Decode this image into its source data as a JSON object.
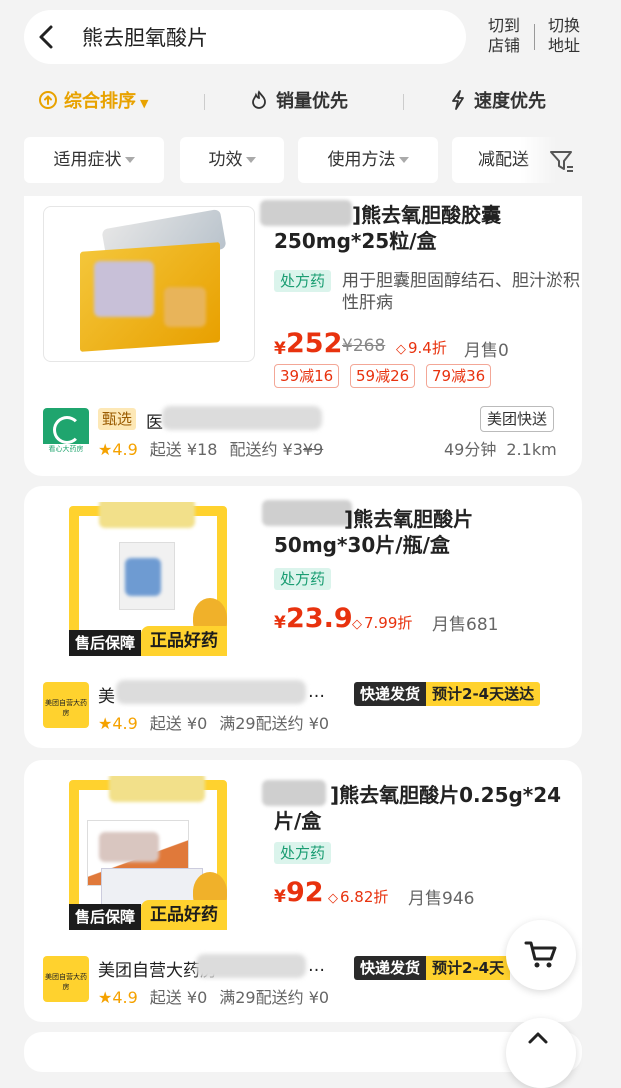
{
  "header": {
    "search_query": "熊去胆氧酸片",
    "action1": [
      "切到",
      "店铺"
    ],
    "action2": [
      "切换",
      "地址"
    ]
  },
  "sort": {
    "items": [
      "综合排序",
      "销量优先",
      "速度优先"
    ],
    "active_index": 0,
    "active_color": "#e8a200"
  },
  "filters": [
    "适用症状",
    "功效",
    "使用方法",
    "减配送"
  ],
  "products": [
    {
      "title_line1": "]熊去氧胆酸胶囊",
      "title_line2": "250mg*25粒/盒",
      "rx_badge": "处方药",
      "description": "用于胆囊胆固醇结石、胆汁淤积性肝病",
      "yen": "¥",
      "price": "252",
      "original_price": "¥268",
      "discount": "9.4折",
      "monthly_sales": "月售0",
      "coupons": [
        "39减16",
        "59减26",
        "79减36"
      ],
      "shop_badge": "甄选",
      "shop_name_visible": "医",
      "rating": "4.9",
      "min_order": "起送 ¥18",
      "delivery_fee": "配送约 ¥3",
      "delivery_fee_original": "¥9",
      "delivery_badge": "美团快送",
      "eta": "49分钟",
      "distance": "2.1km",
      "logo_text": "看心大药房"
    },
    {
      "title_line1": "]熊去氧胆酸片",
      "title_line2": "50mg*30片/瓶/盒",
      "rx_badge": "处方药",
      "yen": "¥",
      "price": "23.9",
      "discount": "7.99折",
      "monthly_sales": "月售681",
      "image_band_left": "售后保障",
      "image_band_right": "正品好药",
      "shop_name_visible": "美",
      "shop_name_tail": "…",
      "rating": "4.9",
      "min_order": "起送 ¥0",
      "delivery_fee": "满29配送约 ¥0",
      "express_a": "快递发货",
      "express_b": "预计2-4天送达",
      "logo_text": "美团自营大药房"
    },
    {
      "title_line1": "]熊去氧胆酸片0.25g*24",
      "title_line2": "片/盒",
      "rx_badge": "处方药",
      "yen": "¥",
      "price": "92",
      "discount": "6.82折",
      "monthly_sales": "月售946",
      "image_band_left": "售后保障",
      "image_band_right": "正品好药",
      "shop_name_visible": "美团自营大药房",
      "shop_name_tail": "…",
      "rating": "4.9",
      "min_order": "起送 ¥0",
      "delivery_fee": "满29配送约 ¥0",
      "express_a": "快递发货",
      "express_b": "预计2-4天",
      "logo_text": "美团自营大药房"
    }
  ],
  "icons": {
    "back": "chevron-left-icon",
    "sort_active": "arrow-up-circle-icon",
    "sales": "flame-icon",
    "speed": "lightning-icon",
    "filter": "funnel-icon",
    "cart": "cart-icon",
    "star": "★",
    "discount_tag": "◇"
  }
}
